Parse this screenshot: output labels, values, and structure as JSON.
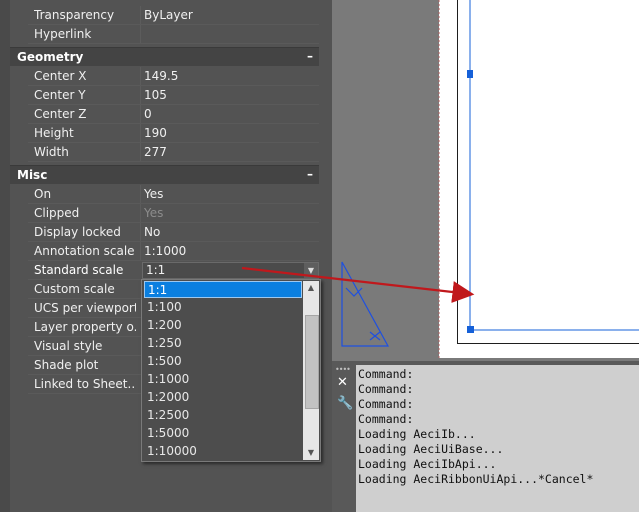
{
  "palette": {
    "top_rows": [
      {
        "label": "Transparency",
        "value": "ByLayer"
      },
      {
        "label": "Hyperlink",
        "value": ""
      }
    ],
    "geometry": {
      "title": "Geometry",
      "collapse": "–",
      "rows": [
        {
          "label": "Center X",
          "value": "149.5"
        },
        {
          "label": "Center Y",
          "value": "105"
        },
        {
          "label": "Center Z",
          "value": "0"
        },
        {
          "label": "Height",
          "value": "190"
        },
        {
          "label": "Width",
          "value": "277"
        }
      ]
    },
    "misc": {
      "title": "Misc",
      "collapse": "–",
      "rows": [
        {
          "label": "On",
          "value": "Yes"
        },
        {
          "label": "Clipped",
          "value": "Yes"
        },
        {
          "label": "Display locked",
          "value": "No"
        },
        {
          "label": "Annotation scale",
          "value": "1:1000"
        },
        {
          "label": "Standard scale",
          "value": "1:1"
        },
        {
          "label": "Custom scale",
          "value": ""
        },
        {
          "label": "UCS per viewport",
          "value": ""
        },
        {
          "label": "Layer property o...",
          "value": ""
        },
        {
          "label": "Visual style",
          "value": ""
        },
        {
          "label": "Shade plot",
          "value": ""
        },
        {
          "label": "Linked to Sheet...",
          "value": ""
        }
      ]
    }
  },
  "dropdown": {
    "selected": "1:1",
    "options": [
      "1:1",
      "1:100",
      "1:200",
      "1:250",
      "1:500",
      "1:1000",
      "1:2000",
      "1:2500",
      "1:5000",
      "1:10000"
    ]
  },
  "command_line": {
    "lines": [
      "Command:",
      "Command:",
      "Command:",
      "Command:",
      "Loading AeciIb...",
      "Loading AeciUiBase...",
      "Loading AeciIbApi...",
      "Loading AeciRibbonUiApi...*Cancel*"
    ]
  },
  "colors": {
    "palette_bg": "#535353",
    "section_bg": "#444444",
    "selection": "#0a7fe0",
    "annotation_arrow": "#c0181c",
    "viewport_blue": "#1560d8"
  }
}
